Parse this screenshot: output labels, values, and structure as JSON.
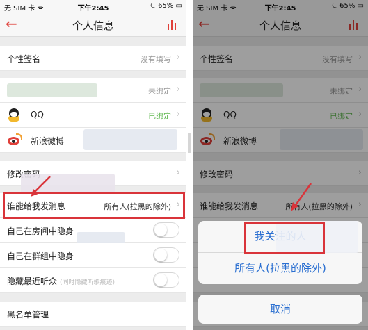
{
  "colors": {
    "accent": "#e0403a",
    "bound": "#5fb74f",
    "link": "#2a6fd1",
    "highlight": "#d9343a"
  },
  "left": {
    "status": {
      "carrier": "无 SIM 卡 ᯤ",
      "time": "下午2:45",
      "battery": "⏾ 65% ▭"
    },
    "nav": {
      "back": "←",
      "title": "个人信息"
    },
    "rows": {
      "signature": {
        "label": "个性签名",
        "value": "没有填写",
        "chev": "›"
      },
      "phone": {
        "value": "未绑定",
        "chev": "›"
      },
      "qq": {
        "label": "QQ",
        "value": "已绑定",
        "chev": "›"
      },
      "weibo": {
        "label": "新浪微博"
      },
      "password": {
        "label": "修改密码",
        "chev": "›"
      },
      "who_can_message": {
        "label": "谁能给我发消息",
        "value": "所有人(拉黑的除外)",
        "chev": "›"
      },
      "hide_in_room": {
        "label": "自己在房间中隐身"
      },
      "hide_in_group": {
        "label": "自己在群组中隐身"
      },
      "hide_listeners": {
        "label": "隐藏最近听众",
        "hint": "(同时隐藏听歌痕迹)"
      },
      "blacklist": {
        "label": "黑名单管理"
      }
    }
  },
  "right": {
    "status": {
      "carrier": "无 SIM 卡 ᯤ",
      "time": "下午2:45",
      "battery": "⏾ 65% ▭"
    },
    "nav": {
      "back": "←",
      "title": "个人信息"
    },
    "rows": {
      "signature": {
        "label": "个性签名",
        "value": "没有填写",
        "chev": "›"
      },
      "phone": {
        "value": "未绑定",
        "chev": "›"
      },
      "qq": {
        "label": "QQ",
        "value": "已绑定",
        "chev": "›"
      },
      "weibo": {
        "label": "新浪微博"
      },
      "password": {
        "label": "修改密码",
        "chev": "›"
      },
      "who_can_message": {
        "label": "谁能给我发消息",
        "value": "所有人(拉黑的除外)",
        "chev": "›"
      }
    },
    "sheet": {
      "option_following": "我关注的人",
      "option_everyone": "所有人(拉黑的除外)",
      "cancel": "取消"
    }
  }
}
